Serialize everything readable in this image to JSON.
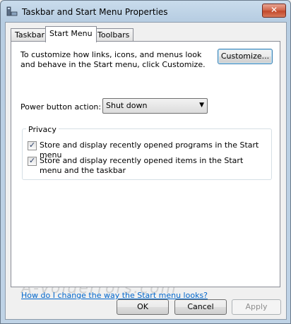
{
  "window": {
    "title": "Taskbar and Start Menu Properties",
    "close_label": "✕"
  },
  "tabs": [
    {
      "label": "Taskbar"
    },
    {
      "label": "Start Menu"
    },
    {
      "label": "Toolbars"
    }
  ],
  "start_menu": {
    "description": "To customize how links, icons, and menus look and behave in the Start menu, click Customize.",
    "customize_label": "Customize...",
    "power_label": "Power button action:",
    "power_value": "Shut down",
    "privacy": {
      "label": "Privacy",
      "items": [
        {
          "label": "Store and display recently opened programs in the Start menu",
          "checked": true
        },
        {
          "label": "Store and display recently opened items in the Start menu and the taskbar",
          "checked": true
        }
      ]
    },
    "help_link": "How do I change the way the Start menu looks?"
  },
  "footer": {
    "ok": "OK",
    "cancel": "Cancel",
    "apply": "Apply"
  },
  "watermark": "A-Voiderrors.com",
  "icons": {
    "title": "taskbar-properties-icon",
    "close": "close-icon",
    "dropdown": "chevron-down-icon",
    "check": "checkmark-icon"
  },
  "colors": {
    "link": "#0066cc",
    "close_button": "#c2482b",
    "titlebar": "#b7cde2"
  }
}
